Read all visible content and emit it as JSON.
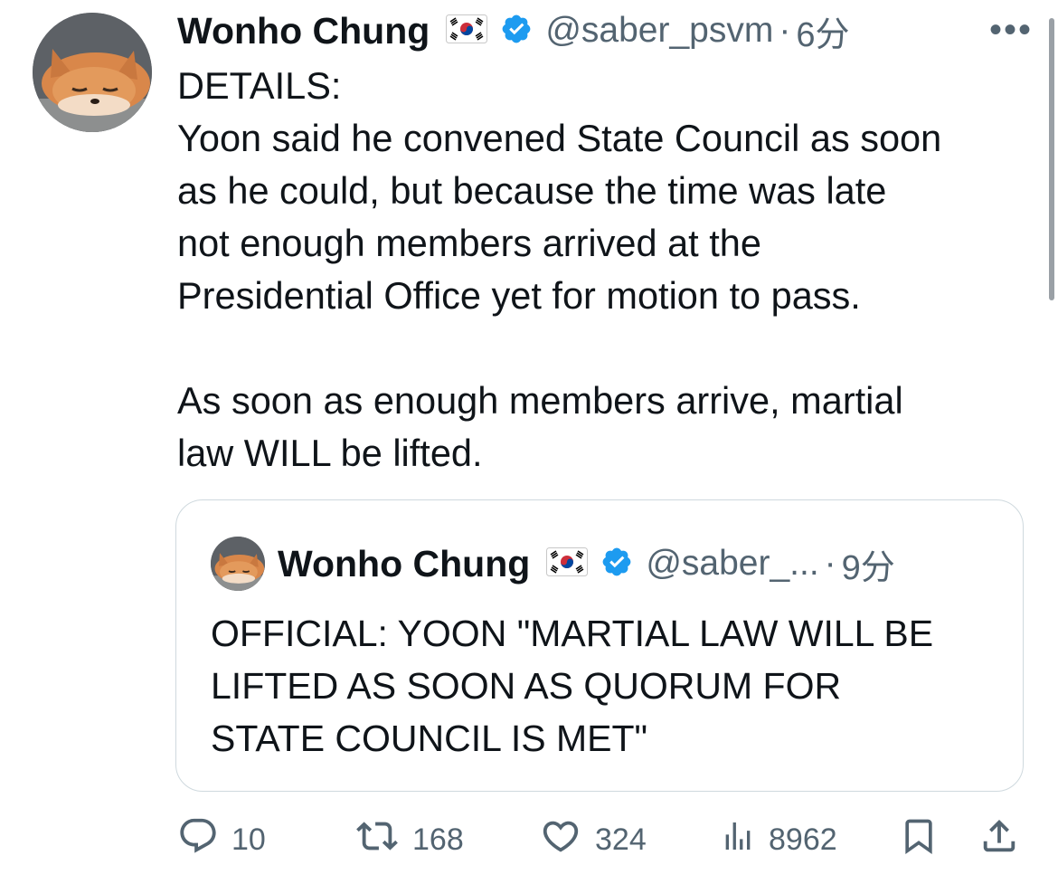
{
  "tweet": {
    "author_name": "Wonho Chung",
    "flag_icon": "south-korea-flag",
    "handle": "@saber_psvm",
    "separator": "·",
    "time": "6分",
    "more_label": "•••",
    "body_lines": [
      "DETAILS:",
      "Yoon said he convened State Council as soon",
      "as he could, but because the time was late",
      "not enough members arrived at the",
      "Presidential Office yet for motion to pass.",
      "",
      "As soon as enough members arrive, martial",
      "law WILL be lifted."
    ]
  },
  "quote": {
    "author_name": "Wonho Chung",
    "handle": "@saber_...",
    "separator": "·",
    "time": "9分",
    "body_lines": [
      "OFFICIAL: YOON \"MARTIAL LAW WILL BE",
      "LIFTED AS SOON AS QUORUM FOR",
      "STATE COUNCIL IS MET\""
    ]
  },
  "actions": {
    "replies": "10",
    "reposts": "168",
    "likes": "324",
    "views": "8962"
  },
  "colors": {
    "verified_blue": "#1d9bf0",
    "secondary_text": "#536471",
    "primary_text": "#0f1419",
    "border": "#cfd9de"
  }
}
